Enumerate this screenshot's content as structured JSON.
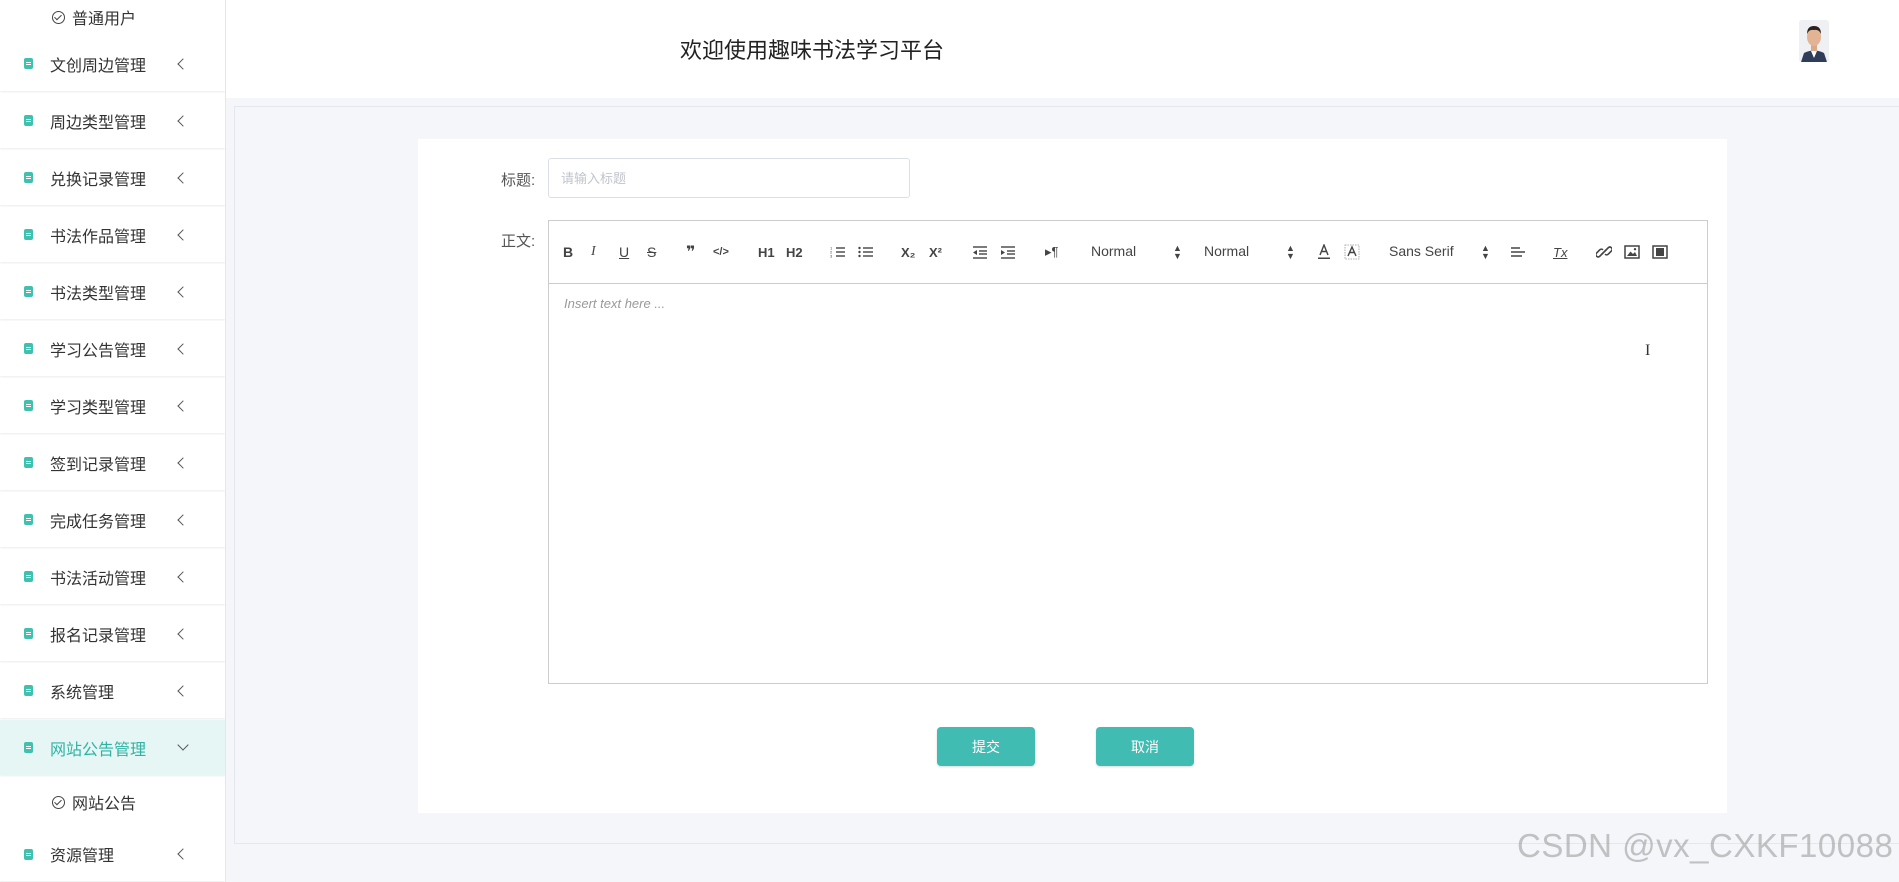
{
  "header": {
    "title": "欢迎使用趣味书法学习平台"
  },
  "sidebar": {
    "top_subitem": "普通用户",
    "items": [
      {
        "label": "文创周边管理"
      },
      {
        "label": "周边类型管理"
      },
      {
        "label": "兑换记录管理"
      },
      {
        "label": "书法作品管理"
      },
      {
        "label": "书法类型管理"
      },
      {
        "label": "学习公告管理"
      },
      {
        "label": "学习类型管理"
      },
      {
        "label": "签到记录管理"
      },
      {
        "label": "完成任务管理"
      },
      {
        "label": "书法活动管理"
      },
      {
        "label": "报名记录管理"
      },
      {
        "label": "系统管理"
      }
    ],
    "active_item": {
      "label": "网站公告管理",
      "color": "#2fb3a4"
    },
    "active_subitem": "网站公告",
    "last_item": {
      "label": "资源管理"
    }
  },
  "form": {
    "title_label": "标题:",
    "title_placeholder": "请输入标题",
    "title_value": "",
    "content_label": "正文:",
    "editor_placeholder": "Insert text here ...",
    "toolbar": {
      "bold": "B",
      "italic": "I",
      "underline": "U",
      "strike": "S",
      "blockquote": "❞",
      "code": "</>",
      "h1": "H1",
      "h2": "H2",
      "sub": "X₂",
      "sup": "X²",
      "direction": "▸¶",
      "size_select": "Normal",
      "header_select": "Normal",
      "font_select": "Sans Serif",
      "clean": "Tx"
    },
    "submit_label": "提交",
    "cancel_label": "取消",
    "button_color": "#40bcb2"
  },
  "watermark": "CSDN @vx_CXKF10088"
}
